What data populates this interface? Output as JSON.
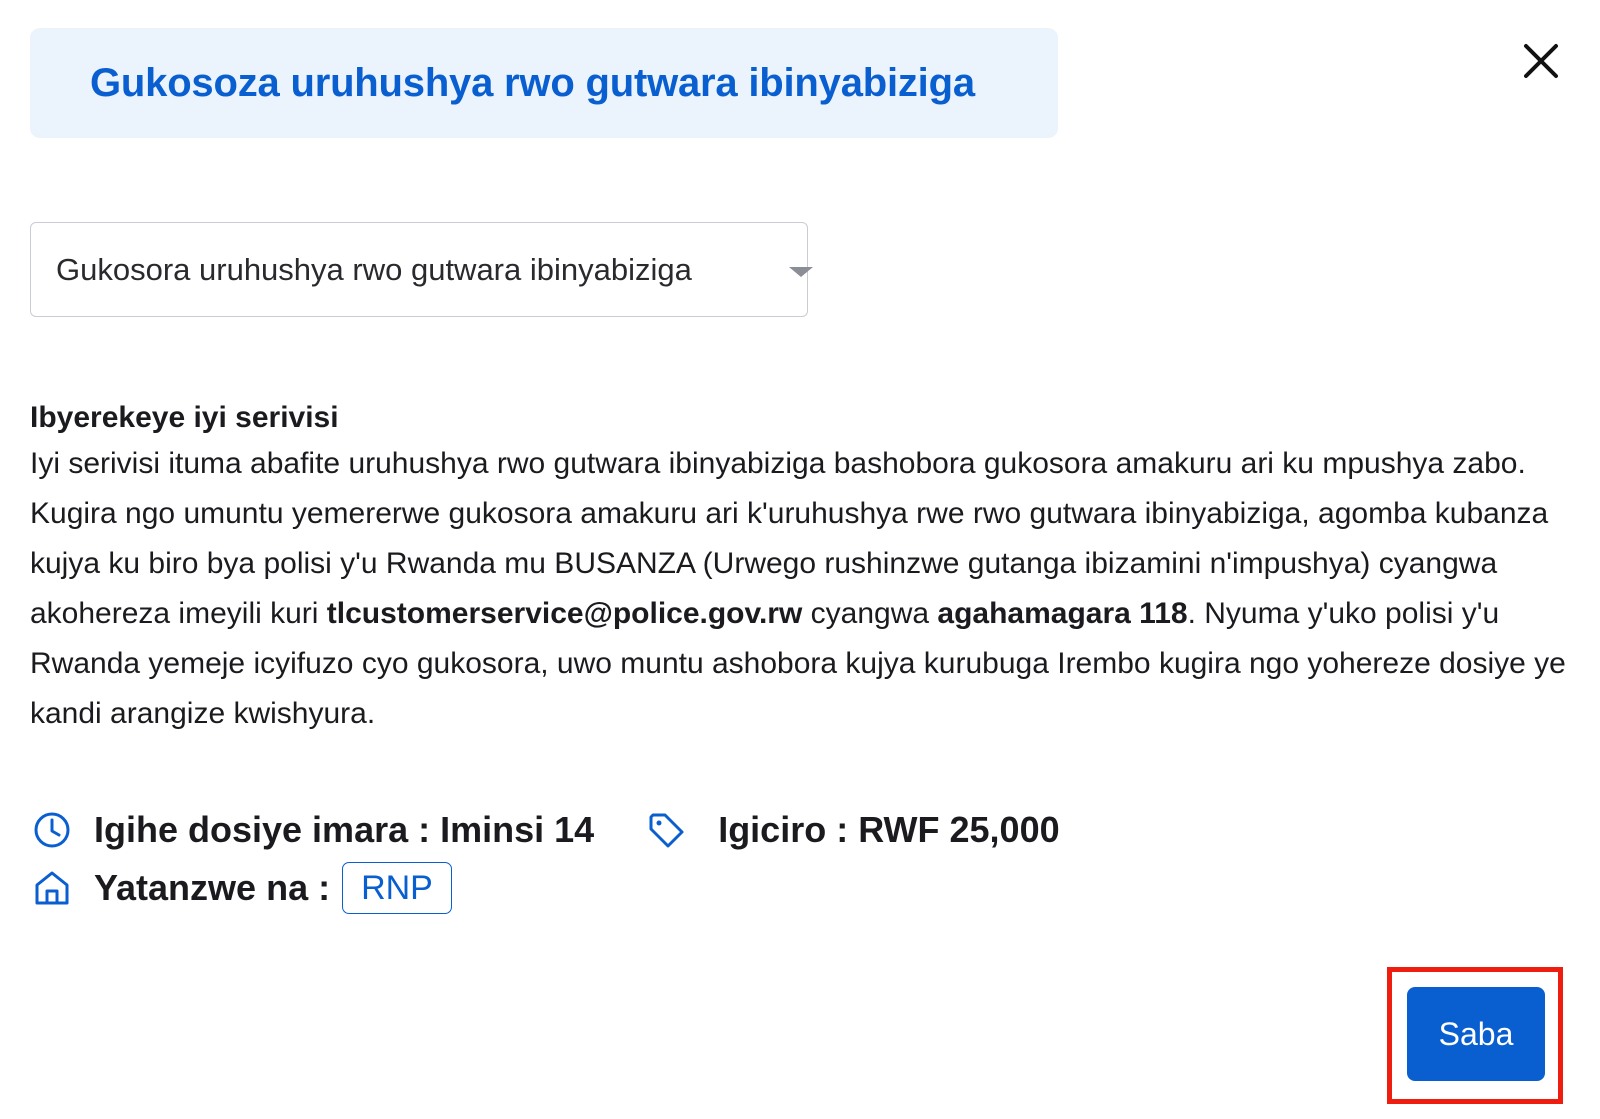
{
  "header": {
    "title": "Gukosoza uruhushya rwo gutwara ibinyabiziga"
  },
  "service_select": {
    "selected": "Gukosora uruhushya rwo gutwara ibinyabiziga"
  },
  "about": {
    "heading": "Ibyerekeye iyi serivisi",
    "text_1": "Iyi serivisi ituma abafite uruhushya rwo gutwara ibinyabiziga bashobora gukosora amakuru ari ku mpushya zabo. Kugira ngo umuntu yemererwe gukosora amakuru ari k'uruhushya rwe rwo gutwara ibinyabiziga, agomba kubanza kujya ku biro bya polisi y'u Rwanda mu BUSANZA (Urwego rushinzwe gutanga ibizamini n'impushya) cyangwa akohereza imeyili kuri ",
    "email": "tlcustomerservice@police.gov.rw",
    "text_2": " cyangwa ",
    "phone": "agahamagara 118",
    "text_3": ". Nyuma y'uko polisi y'u Rwanda yemeje icyifuzo cyo gukosora, uwo muntu ashobora kujya kurubuga Irembo kugira ngo yohereze dosiye ye kandi arangize kwishyura."
  },
  "meta": {
    "processing_time": "Igihe dosiye imara : Iminsi 14",
    "price": "Igiciro : RWF 25,000",
    "provider_label": "Yatanzwe na :",
    "provider": "RNP",
    "icons": {
      "time": "clock-icon",
      "price": "price-tag-icon",
      "provider": "home-icon",
      "close": "close-icon"
    }
  },
  "actions": {
    "submit_label": "Saba"
  },
  "colors": {
    "accent": "#0a5fd0",
    "title_bg": "#ebf3fd",
    "highlight": "#ef1d0f"
  }
}
